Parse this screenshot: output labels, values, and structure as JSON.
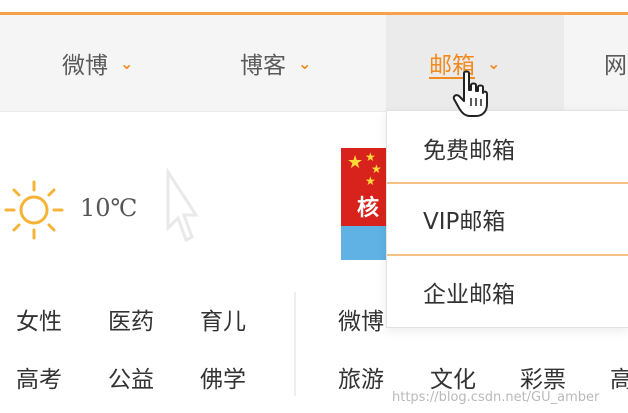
{
  "nav": {
    "items": [
      {
        "label": "微博",
        "chevron": "⌄"
      },
      {
        "label": "博客",
        "chevron": "⌄"
      },
      {
        "label": "邮箱",
        "chevron": "⌄"
      },
      {
        "label": "网",
        "chevron": ""
      }
    ],
    "active_index": 2
  },
  "weather": {
    "icon": "sun-icon",
    "temperature": "10℃"
  },
  "banner": {
    "text": "核"
  },
  "dropdown": {
    "items": [
      {
        "label": "免费邮箱"
      },
      {
        "label": "VIP邮箱"
      },
      {
        "label": "企业邮箱"
      }
    ]
  },
  "categories": {
    "left": [
      "女性",
      "医药",
      "育儿",
      "高考",
      "公益",
      "佛学"
    ],
    "right": [
      "微博",
      "旅游",
      "文化",
      "彩票",
      "高"
    ]
  },
  "watermark": "https://blog.csdn.net/GU_amber",
  "colors": {
    "accent": "#f28a1f",
    "separator": "#f7c28a",
    "top_line": "#f7a14a"
  }
}
